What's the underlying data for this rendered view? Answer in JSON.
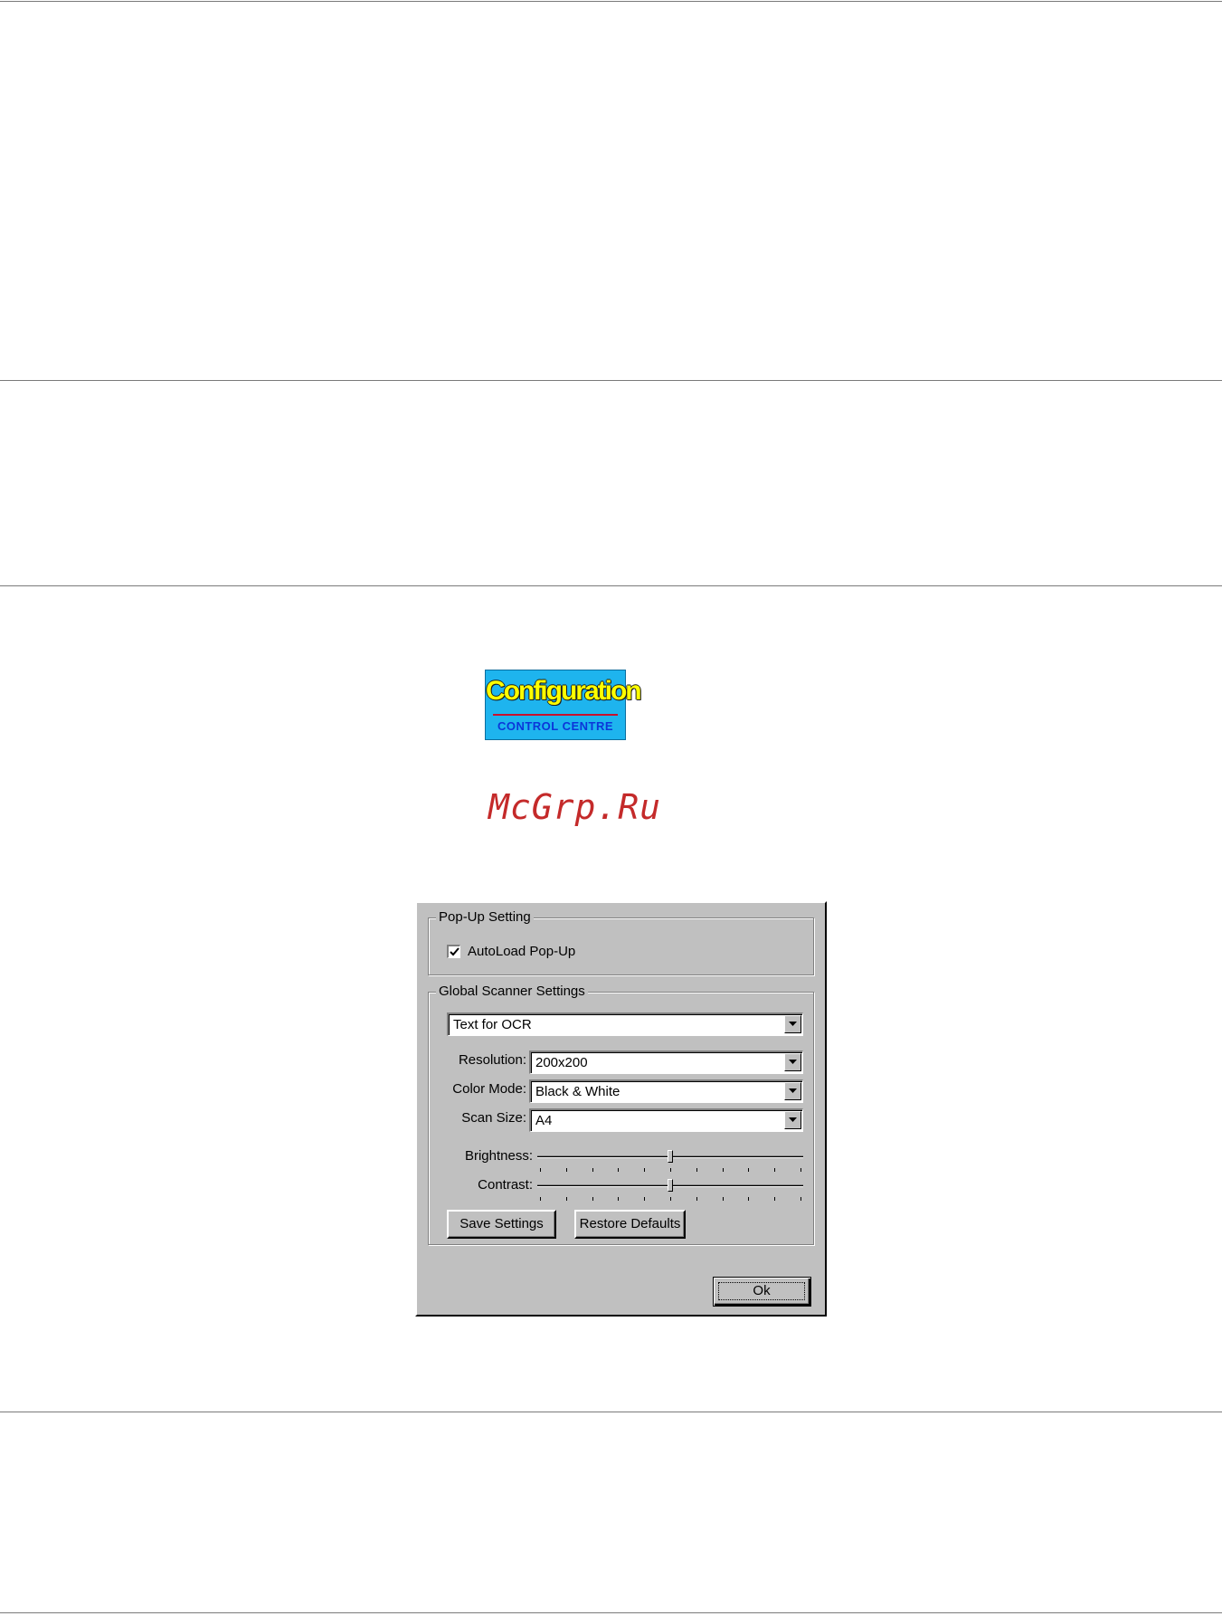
{
  "badge": {
    "title": "Configuration",
    "subtitle": "CONTROL CENTRE"
  },
  "watermark": "McGrp.Ru",
  "dialog": {
    "popup_group": {
      "title": "Pop-Up Setting",
      "autoload_label": "AutoLoad Pop-Up",
      "autoload_checked": true
    },
    "scanner_group": {
      "title": "Global Scanner Settings",
      "profile_value": "Text for OCR",
      "resolution_label": "Resolution:",
      "resolution_value": "200x200",
      "color_mode_label": "Color Mode:",
      "color_mode_value": "Black & White",
      "scan_size_label": "Scan Size:",
      "scan_size_value": "A4",
      "brightness_label": "Brightness:",
      "brightness_level": 0.5,
      "contrast_label": "Contrast:",
      "contrast_level": 0.5,
      "save_label": "Save Settings",
      "restore_label": "Restore Defaults"
    },
    "ok_label": "Ok"
  },
  "colors": {
    "dialog_face": "#c0c0c0",
    "badge_bg": "#1eb4ee",
    "badge_title": "#ffff00",
    "badge_subtitle": "#0b36d9",
    "watermark": "#c42a2a"
  }
}
